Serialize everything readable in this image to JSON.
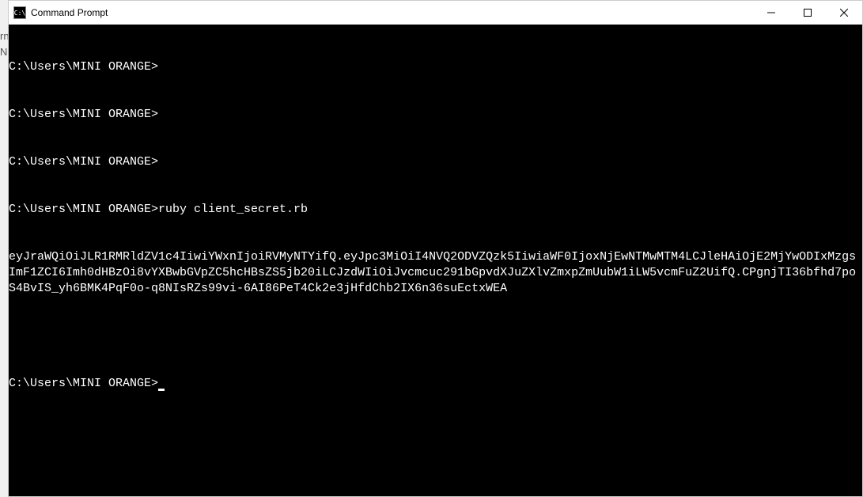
{
  "window": {
    "title": "Command Prompt",
    "icon_label": "C:\\"
  },
  "terminal": {
    "lines": [
      "C:\\Users\\MINI ORANGE>",
      "C:\\Users\\MINI ORANGE>",
      "C:\\Users\\MINI ORANGE>",
      "C:\\Users\\MINI ORANGE>ruby client_secret.rb"
    ],
    "output": "eyJraWQiOiJLR1RMRldZV1c4IiwiYWxnIjoiRVMyNTYifQ.eyJpc3MiOiI4NVQ2ODVZQzk5IiwiaWF0IjoxNjEwNTMwMTM4LCJleHAiOjE2MjYwODIxMzgsImF1ZCI6Imh0dHBzOi8vYXBwbGVpZC5hcHBsZS5jb20iLCJzdWIiOiJvcmcuc291bGpvdXJuZXlvZmxpZmUubW1iLW5vcmFuZ2UifQ.CPgnjTI36bfhd7poS4BvIS_yh6BMK4PqF0o-q8NIsRZs99vi-6AI86PeT4Ck2e3jHfdChb2IX6n36suEctxWEA",
    "prompt_after": "C:\\Users\\MINI ORANGE>"
  },
  "bg": {
    "l1": "rn",
    "l2": "Nc"
  }
}
